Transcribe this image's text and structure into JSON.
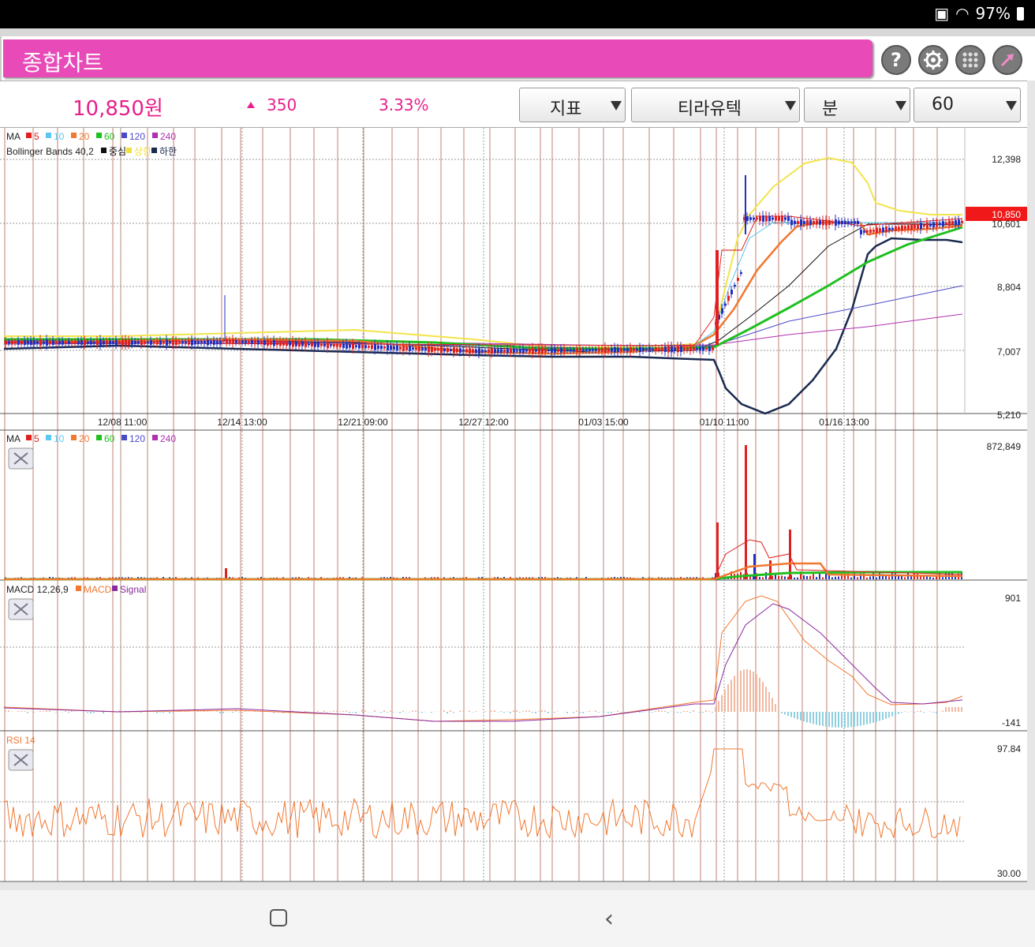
{
  "status": {
    "battery_text": "97%"
  },
  "app": {
    "title": "종합차트",
    "price": "10,850원",
    "change": "350",
    "change_pct": "3.33%",
    "colors": {
      "header": "#e84bb8",
      "up": "#e8208c"
    }
  },
  "toolbar": {
    "indicator": "지표",
    "stock": "티라유텍",
    "period_type": "분",
    "period_value": "60"
  },
  "icons": [
    "help-icon",
    "settings-icon",
    "grid-icon",
    "expand-icon"
  ],
  "main_chart": {
    "legend_ma": "MA",
    "ma_items": [
      {
        "label": "5",
        "color": "#e02020"
      },
      {
        "label": "10",
        "color": "#5ac8f0"
      },
      {
        "label": "20",
        "color": "#f07830"
      },
      {
        "label": "60",
        "color": "#20c020"
      },
      {
        "label": "120",
        "color": "#4a4ac8"
      },
      {
        "label": "240",
        "color": "#b030b0"
      }
    ],
    "legend_bb": "Bollinger Bands 40,2",
    "bb_items": [
      {
        "label": "중심",
        "color": "#111111"
      },
      {
        "label": "상한",
        "color": "#f0e040"
      },
      {
        "label": "하한",
        "color": "#1a2a50"
      }
    ],
    "y_ticks": [
      "12,398",
      "10,601",
      "8,804",
      "7,007",
      "5,210"
    ],
    "x_ticks": [
      "12/08 11:00",
      "12/14 13:00",
      "12/21 09:00",
      "12/27 12:00",
      "01/03 15:00",
      "01/10 11:00",
      "01/16 13:00"
    ],
    "current_price_tag": "10,850"
  },
  "volume_chart": {
    "legend_ma": "MA",
    "ma_items": [
      {
        "label": "5",
        "color": "#e02020"
      },
      {
        "label": "10",
        "color": "#5ac8f0"
      },
      {
        "label": "20",
        "color": "#f07830"
      },
      {
        "label": "60",
        "color": "#20c020"
      },
      {
        "label": "120",
        "color": "#4a4ac8"
      },
      {
        "label": "240",
        "color": "#b030b0"
      }
    ],
    "y_tick": "872,849"
  },
  "macd_chart": {
    "legend": "MACD 12,26,9",
    "items": [
      {
        "label": "MACD",
        "color": "#f07830"
      },
      {
        "label": "Signal",
        "color": "#8a2aa0"
      }
    ],
    "y_ticks": [
      "901",
      "-141"
    ]
  },
  "rsi_chart": {
    "legend": "RSI 14",
    "y_ticks": [
      "97.84",
      "30.00"
    ]
  }
}
